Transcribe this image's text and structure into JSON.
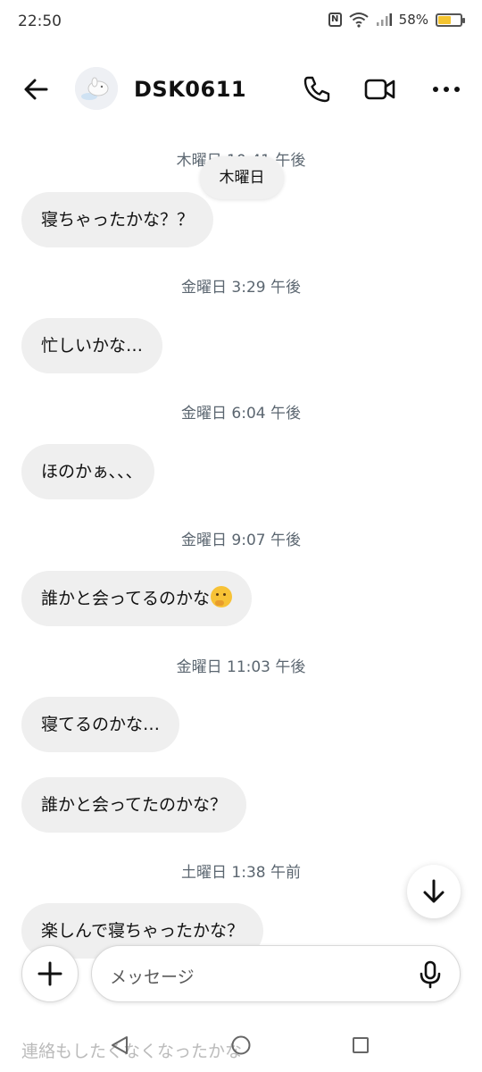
{
  "status_bar": {
    "time": "22:50",
    "nfc": "N",
    "battery_percent": "58%",
    "battery_level": 0.58,
    "icons": [
      "nfc-icon",
      "wifi-icon",
      "signal-icon",
      "battery-charging-icon"
    ]
  },
  "header": {
    "contact_name": "DSK0611",
    "icons": [
      "back-arrow-icon",
      "avatar-image",
      "phone-icon",
      "video-camera-icon",
      "more-dots-icon"
    ]
  },
  "day_pill": "木曜日",
  "messages": [
    {
      "timestamp": "木曜日 10:41 午後",
      "text": "寝ちゃったかな？？"
    },
    {
      "timestamp": "金曜日 3:29 午後",
      "text": "忙しいかな…"
    },
    {
      "timestamp": "金曜日 6:04 午後",
      "text": "ほのかぁ､､､"
    },
    {
      "timestamp": "金曜日 9:07 午後",
      "text": "誰かと会ってるのかな",
      "emoji": "thinking-face-emoji"
    },
    {
      "timestamp": "金曜日 11:03 午後",
      "text": "寝てるのかな…"
    },
    {
      "text": "誰かと会ってたのかな？"
    },
    {
      "timestamp": "土曜日 1:38 午前",
      "text": "楽しんで寝ちゃったかな？"
    },
    {
      "text": "連絡もしたくなくなったかな"
    }
  ],
  "composer": {
    "placeholder": "メッセージ",
    "icons": [
      "plus-icon",
      "microphone-icon",
      "arrow-down-icon"
    ]
  },
  "nav_bar": {
    "icons": [
      "nav-back-triangle-icon",
      "nav-home-circle-icon",
      "nav-recent-square-icon"
    ]
  },
  "colors": {
    "bubble": "#efefef",
    "timestamp": "#5b6670",
    "battery": "#f4c430"
  }
}
